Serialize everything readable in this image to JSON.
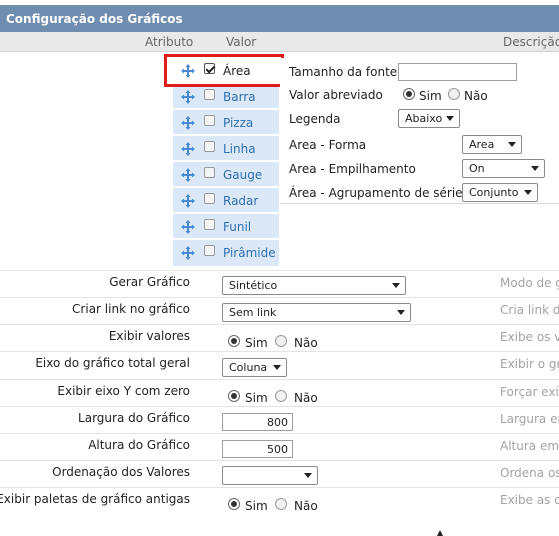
{
  "header": {
    "title": "Configuração dos Gráficos"
  },
  "columns": {
    "attribute": "Atributo",
    "value": "Valor",
    "description": "Descrição"
  },
  "chart_types": [
    {
      "label": "Área",
      "checked": true
    },
    {
      "label": "Barra",
      "checked": false
    },
    {
      "label": "Pizza",
      "checked": false
    },
    {
      "label": "Linha",
      "checked": false
    },
    {
      "label": "Gauge",
      "checked": false
    },
    {
      "label": "Radar",
      "checked": false
    },
    {
      "label": "Funil",
      "checked": false
    },
    {
      "label": "Pirâmide",
      "checked": false
    }
  ],
  "area_settings": {
    "font_size_label": "Tamanho da fonte",
    "font_size_value": "",
    "abbreviated_label": "Valor abreviado",
    "abbreviated_yes": "Sim",
    "abbreviated_no": "Não",
    "legend_label": "Legenda",
    "legend_value": "Abaixo",
    "shape_label": "Area - Forma",
    "shape_value": "Area",
    "stacking_label": "Area - Empilhamento",
    "stacking_value": "On",
    "grouping_label": "Área - Agrupamento de séries",
    "grouping_value": "Conjunto"
  },
  "rows": {
    "generate": {
      "label": "Gerar Gráfico",
      "value": "Sintético",
      "desc": "Modo de gerar"
    },
    "link": {
      "label": "Criar link no gráfico",
      "value": "Sem link",
      "desc": "Cria link de"
    },
    "show_values": {
      "label": "Exibir valores",
      "yes": "Sim",
      "no": "Não",
      "desc": "Exibe os valores"
    },
    "total_axis": {
      "label": "Eixo do gráfico total geral",
      "value": "Coluna",
      "desc": "Exibir o gráfico"
    },
    "y_zero": {
      "label": "Exibir eixo Y com zero",
      "yes": "Sim",
      "no": "Não",
      "desc": "Forçar exibir"
    },
    "width": {
      "label": "Largura do Gráfico",
      "value": "800",
      "desc": "Largura em"
    },
    "height": {
      "label": "Altura do Gráfico",
      "value": "500",
      "desc": "Altura em p"
    },
    "order": {
      "label": "Ordenação dos Valores",
      "value": "",
      "desc": "Ordena os"
    },
    "old_palettes": {
      "label": "Exibir paletas de gráfico antigas",
      "yes": "Sim",
      "no": "Não",
      "desc": "Exibe as op"
    }
  }
}
